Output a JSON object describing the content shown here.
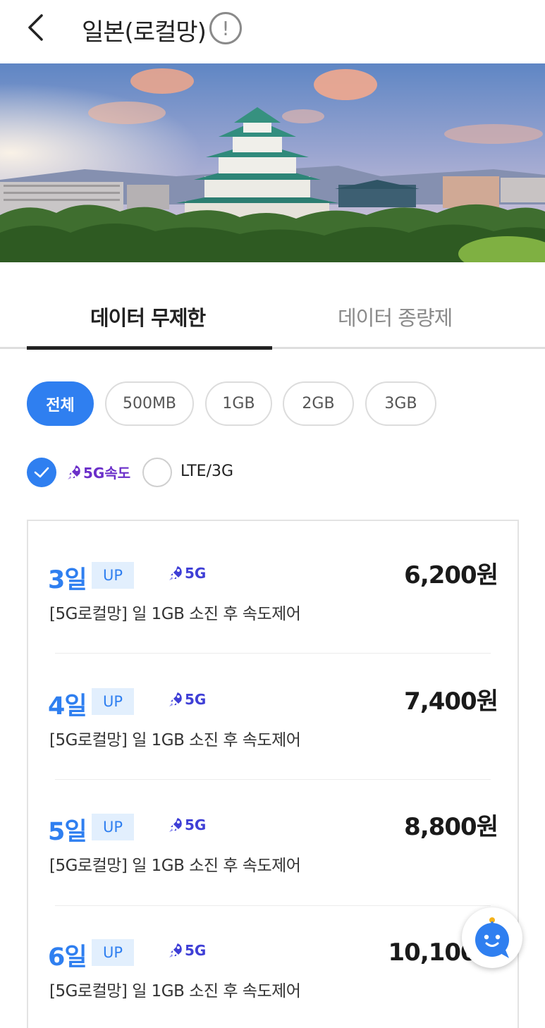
{
  "header": {
    "title": "일본(로컬망)",
    "info_label": "!"
  },
  "tabs": [
    {
      "label": "데이터 무제한",
      "active": true
    },
    {
      "label": "데이터 종량제",
      "active": false
    }
  ],
  "filters": {
    "chips": [
      {
        "label": "전체",
        "active": true
      },
      {
        "label": "500MB",
        "active": false
      },
      {
        "label": "1GB",
        "active": false
      },
      {
        "label": "2GB",
        "active": false
      },
      {
        "label": "3GB",
        "active": false
      }
    ],
    "network": [
      {
        "label": "5G속도",
        "checked": true
      },
      {
        "label": "LTE/3G",
        "checked": false
      }
    ]
  },
  "plans": [
    {
      "days": "3일",
      "badge": "UP",
      "network": "5G",
      "description": "[5G로컬망] 일 1GB 소진 후 속도제어",
      "price": "6,200원"
    },
    {
      "days": "4일",
      "badge": "UP",
      "network": "5G",
      "description": "[5G로컬망] 일 1GB 소진 후 속도제어",
      "price": "7,400원"
    },
    {
      "days": "5일",
      "badge": "UP",
      "network": "5G",
      "description": "[5G로컬망] 일 1GB 소진 후 속도제어",
      "price": "8,800원"
    },
    {
      "days": "6일",
      "badge": "UP",
      "network": "5G",
      "description": "[5G로컬망] 일 1GB 소진 후 속도제어",
      "price": "10,100원"
    }
  ],
  "colors": {
    "accent": "#2f7ff0",
    "badge_bg": "#e2effd",
    "purple_5g": "#6b2fc9",
    "blue_5g": "#3f3fd6"
  },
  "icons": {
    "back": "chevron-left-icon",
    "info": "info-icon",
    "rocket": "rocket-icon",
    "check": "check-icon",
    "chatbot": "chatbot-icon"
  }
}
